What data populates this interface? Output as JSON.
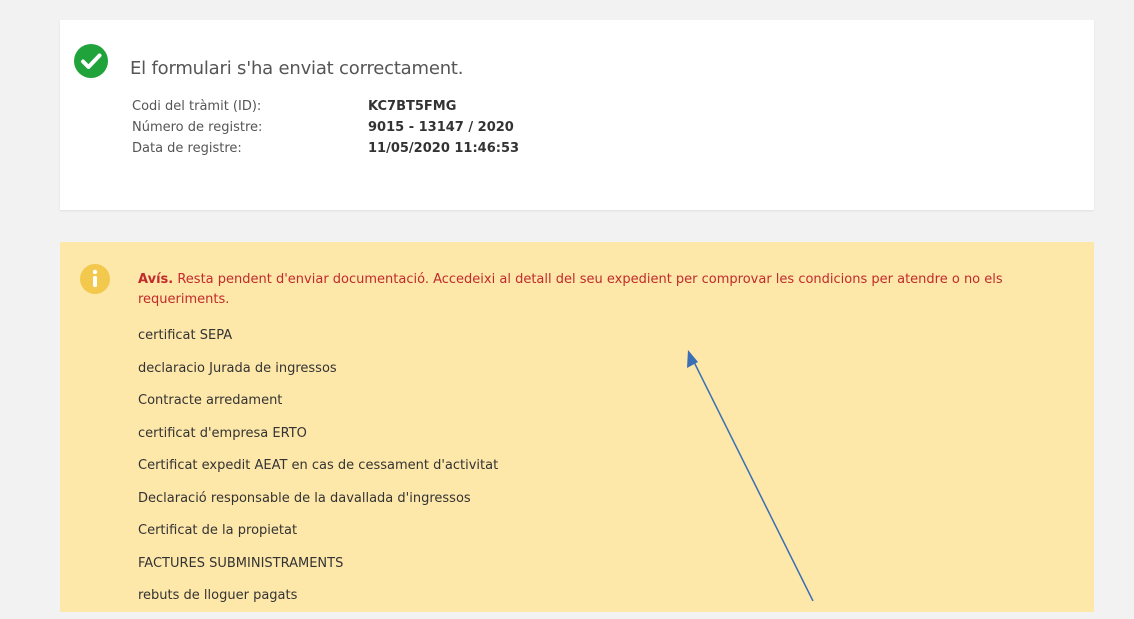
{
  "success": {
    "title": "El formulari s'ha enviat correctament.",
    "rows": [
      {
        "label": "Codi del tràmit (ID):",
        "value": "KC7BT5FMG"
      },
      {
        "label": "Número de registre:",
        "value": "9015 - 13147 / 2020"
      },
      {
        "label": "Data de registre:",
        "value": "11/05/2020 11:46:53"
      }
    ],
    "icon": "check-circle-icon",
    "color": "#1fa33a"
  },
  "warning": {
    "prefix": "Avís.",
    "message": "Resta pendent d'enviar documentació. Accedeixi al detall del seu expedient per comprovar les condicions per atendre o no els requeriments.",
    "icon": "info-circle-icon",
    "icon_color": "#f2c94c",
    "background": "#fde7a9",
    "text_color": "#c22b2b",
    "documents": [
      "certificat SEPA",
      "declaracio Jurada de ingressos",
      "Contracte arredament",
      "certificat d'empresa ERTO",
      "Certificat expedit AEAT en cas de cessament d'activitat",
      "Declaració responsable de la davallada d'ingressos",
      "Certificat de la propietat",
      "FACTURES SUBMINISTRAMENTS",
      "rebuts de lloguer pagats"
    ]
  },
  "annotation": {
    "icon": "arrow-annotation",
    "color": "#3a6fb5"
  }
}
